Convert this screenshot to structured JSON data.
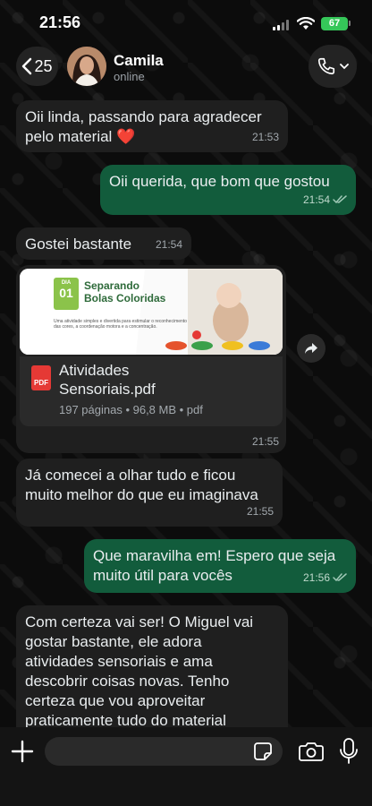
{
  "status_bar": {
    "time": "21:56",
    "battery": "67"
  },
  "header": {
    "back_count": "25",
    "contact_name": "Camila",
    "contact_status": "online"
  },
  "messages": [
    {
      "direction": "in",
      "text": "Oii linda, passando para agradecer\npelo material ❤️",
      "time": "21:53"
    },
    {
      "direction": "out",
      "text": "Oii querida, que bom que gostou",
      "time": "21:54",
      "read": true
    },
    {
      "direction": "in",
      "text": "Gostei bastante",
      "time": "21:54"
    },
    {
      "direction": "in",
      "type": "document",
      "preview": {
        "badge_top": "DIA",
        "badge_num": "01",
        "title": "Separando\nBolas Coloridas",
        "description": "Uma atividade simples e divertida para estimular o reconhecimento das cores, a coordenação motora e a concentração."
      },
      "file_name": "Atividades\nSensoriais.pdf",
      "file_details": "197 páginas • 96,8 MB • pdf",
      "time": "21:55"
    },
    {
      "direction": "in",
      "text": "Já comecei a olhar tudo e ficou\nmuito melhor do que eu imaginava",
      "time": "21:55"
    },
    {
      "direction": "out",
      "text": "Que maravilha em! Espero que seja\nmuito útil para vocês",
      "time": "21:56",
      "read": true
    },
    {
      "direction": "in",
      "text": "Com certeza vai ser! O Miguel vai\ngostar bastante, ele adora\natividades sensoriais e ama\ndescobrir coisas novas. Tenho\ncerteza que vou aproveitar\npraticamente tudo do material"
    }
  ],
  "input": {
    "value": "",
    "placeholder": ""
  },
  "colors": {
    "incoming": "#1f1f1f",
    "outgoing": "#125c3c",
    "accent": "#35c759",
    "pdf": "#e53935"
  }
}
